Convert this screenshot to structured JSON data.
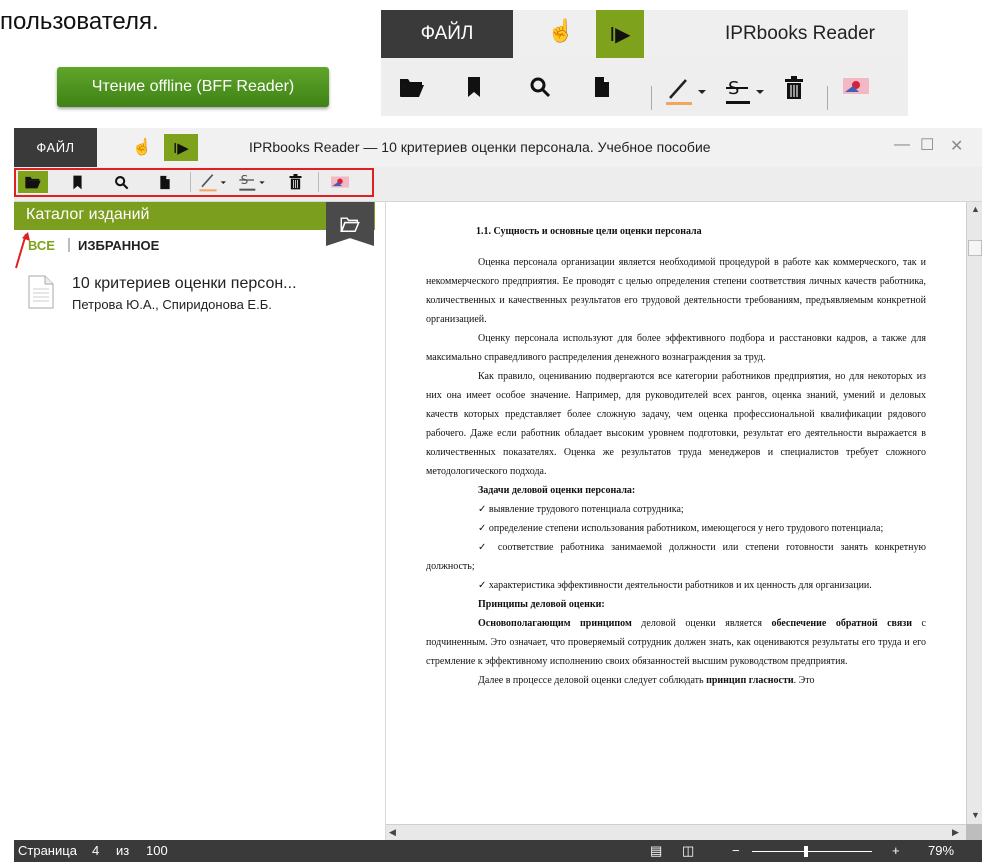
{
  "intro": {
    "text": "пользователя.",
    "offline_button": "Чтение offline (BFF Reader)"
  },
  "zoom_preview": {
    "file_label": "ФАЙЛ",
    "title": "IPRbooks Reader"
  },
  "window": {
    "file_label": "ФАЙЛ",
    "title": "IPRbooks Reader — 10 критериев оценки персонала. Учебное пособие"
  },
  "sidebar": {
    "catalog_label": "Каталог изданий",
    "filter_all": "ВСЕ",
    "filter_favorites": "ИЗБРАННОЕ",
    "book": {
      "title": "10 критериев оценки персон...",
      "authors": "Петрова Ю.А., Спиридонова Е.Б."
    }
  },
  "document": {
    "heading": "1.1. Сущность и основные цели оценки персонала",
    "p1": "Оценка персонала организации является необходимой процедурой в работе как коммерческого, так и некоммерческого предприятия. Ее проводят с целью определения степени соответствия личных качеств работника, количественных и качественных результатов его трудовой деятельности требованиям, предъявляемым конкретной организацией.",
    "p2": "Оценку персонала используют для более эффективного подбора и расстановки кадров, а также для максимально справедливого распределения денежного вознаграждения за труд.",
    "p3": "Как правило, оцениванию подвергаются все категории работников предприятия, но для некоторых из них она имеет особое значение. Например, для руководителей всех рангов, оценка знаний, умений и деловых качеств которых представляет более сложную задачу, чем оценка профессиональной квалификации рядового рабочего. Даже если работник обладает высоким уровнем подготовки, результат его деятельности выражается в количественных показателях. Оценка же результатов труда менеджеров и специалистов требует сложного методологического подхода.",
    "tasks_heading": "Задачи деловой оценки персонала:",
    "task1": "✓ выявление трудового потенциала сотрудника;",
    "task2": "✓ определение степени использования работником, имеющегося у него трудового потенциала;",
    "task3": "✓ соответствие работника занимаемой должности или степени готовности занять конкретную должность;",
    "task4": "✓ характеристика эффективности деятельности работников и их ценность для организации.",
    "principles_heading": "Принципы деловой оценки:",
    "p4_bold1": "Основополагающим принципом",
    "p4_mid": " деловой оценки является ",
    "p4_bold2": "обеспечение обратной связи",
    "p4_rest": " с подчиненным. Это означает, что проверяемый сотрудник должен знать, как оцениваются результаты его труда и его стремление к эффективному исполнению своих обязанностей высшим руководством предприятия.",
    "p5_start": "Далее в процессе деловой оценки следует соблюдать ",
    "p5_bold": "принцип гласности",
    "p5_end": ". Это"
  },
  "status": {
    "page_label": "Страница",
    "page_current": "4",
    "page_of": "из",
    "page_total": "100",
    "zoom_minus": "−",
    "zoom_plus": "+",
    "zoom_value": "79%"
  },
  "colors": {
    "accent_green": "#7ea21c",
    "dark": "#3a3a3a",
    "highlight_red": "#e02020"
  }
}
